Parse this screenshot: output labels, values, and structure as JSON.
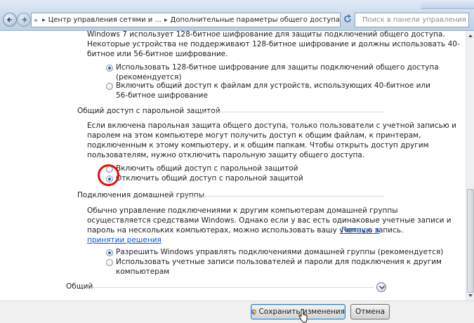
{
  "address_bar": {
    "crumbs": [
      "Центр управления сетями и ...",
      "Дополнительные параметры общего доступа"
    ],
    "separator": "▸",
    "search_placeholder": "Поиск в панели управления"
  },
  "encryption": {
    "intro_lines": [
      "Windows 7 использует 128-битное шифрование для защиты подключений общего доступа.",
      "Некоторые устройства не поддерживают 128-битное шифрование и должны использовать 40-",
      "битное или 56-битное шифрование."
    ],
    "options": [
      {
        "lines": [
          "Использовать 128-битное шифрование для защиты подключений общего доступа",
          "(рекомендуется)"
        ],
        "selected": true
      },
      {
        "lines": [
          "Включить общий доступ к файлам для устройств, использующих 40-битное или",
          "56-битное шифрование"
        ],
        "selected": false
      }
    ]
  },
  "password_sharing": {
    "title": "Общий доступ с парольной защитой",
    "intro_lines": [
      "Если включена парольная защита общего доступа, только пользователи с учетной записью и",
      "паролем на этом компьютере могут получить доступ к общим файлам, к принтерам,",
      "подключенным к этому компьютеру, и к общим папкам. Чтобы открыть доступ другим",
      "пользователям, нужно отключить парольную защиту общего доступа."
    ],
    "options": [
      {
        "label": "Включить общий доступ с парольной защитой",
        "selected": false
      },
      {
        "label": "Отключить общий доступ с парольной защитой",
        "selected": true
      }
    ]
  },
  "homegroup": {
    "title": "Подключения домашней группы",
    "intro_lines": [
      "Обычно управление подключениями к другим компьютерам домашней группы",
      "осуществляется средствами Windows. Однако если у вас есть одинаковые учетные записи и",
      "пароль на нескольких компьютерах, можно использовать вашу учетную запись."
    ],
    "help_link_1": "Помощь в",
    "help_link_2": "принятии решения",
    "options": [
      {
        "lines": [
          "Разрешить Windows управлять подключениями домашней группы (рекомендуется)"
        ],
        "selected": true
      },
      {
        "lines": [
          "Использовать учетные записи пользователей и пароли для подключения к другим",
          "компьютерам"
        ],
        "selected": false
      }
    ]
  },
  "general_section": {
    "title": "Общий"
  },
  "buttons": {
    "save": "Сохранить изменения",
    "cancel": "Отмена"
  },
  "colors": {
    "accent": "#2f5fae",
    "link": "#1155cc",
    "annotation": "#e01010"
  }
}
